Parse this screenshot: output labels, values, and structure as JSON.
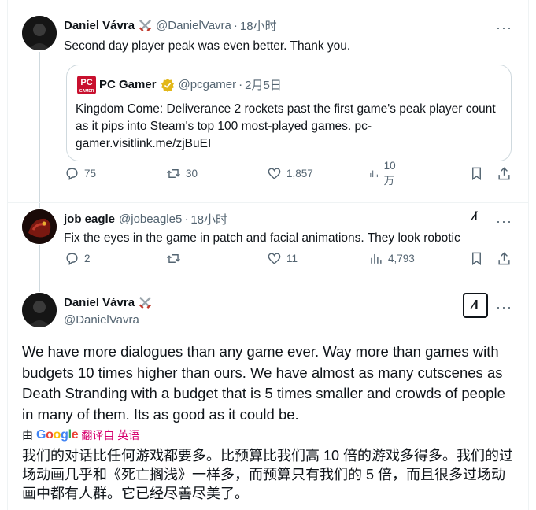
{
  "tweet1": {
    "display_name": "Daniel Vávra",
    "handle": "@DanielVavra",
    "time": "18小时",
    "text": "Second day player peak was even better. Thank you.",
    "quote": {
      "display_name": "PC Gamer",
      "handle": "@pcgamer",
      "time": "2月5日",
      "logo_text": "PC",
      "logo_sub": "GAMER",
      "text": "Kingdom Come: Deliverance 2 rockets past the first game's peak player count as it pips into Steam's top 100 most-played games. pc-gamer.visitlink.me/zjBuEI"
    },
    "replies": "75",
    "retweets": "30",
    "likes": "1,857",
    "views": "10万"
  },
  "tweet2": {
    "display_name": "job eagle",
    "handle": "@jobeagle5",
    "time": "18小时",
    "text": "Fix the eyes in the game in patch and facial animations. They look robotic",
    "replies": "2",
    "retweets": "",
    "likes": "11",
    "views": "4,793"
  },
  "tweet3": {
    "display_name": "Daniel Vávra",
    "handle": "@DanielVavra",
    "text": "We have more dialogues than any game ever. Way more than games with budgets 10 times higher than ours. We have almost as many cutscenes as Death Stranding with a budget that is 5 times smaller and crowds of people in many of them. Its as good as it could be.",
    "translate_prefix": "由",
    "translate_link": "翻译自 英语",
    "translation": "我们的对话比任何游戏都要多。比预算比我们高 10 倍的游戏多得多。我们的过场动画几乎和《死亡搁浅》一样多，而预算只有我们的 5 倍，而且很多过场动画中都有人群。它已经尽善尽美了。"
  },
  "ui": {
    "more_glyph": "···",
    "dot_separator": "·",
    "google_letters": [
      "G",
      "o",
      "o",
      "g",
      "l",
      "e"
    ],
    "grok_glyph": "⁄I"
  },
  "colors": {
    "pc_gamer_red": "#c8102e",
    "verified_gold": "#e2b719",
    "translate_link": "#d6006e",
    "thread_line": "#cfd9de",
    "muted_text": "#536471"
  }
}
